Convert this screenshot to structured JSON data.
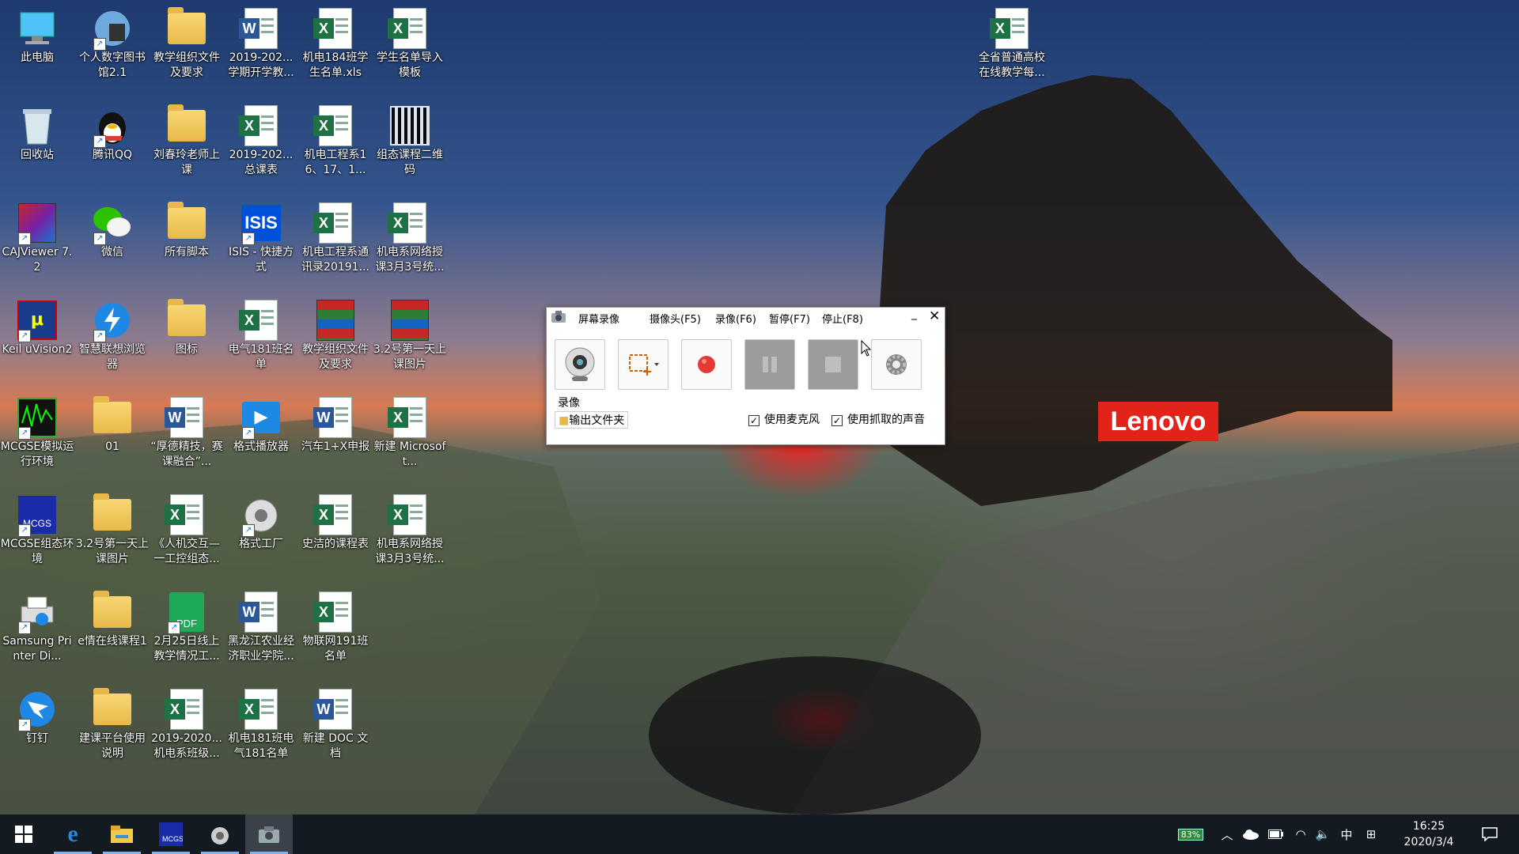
{
  "desktop": {
    "icons": [
      {
        "label": "此电脑",
        "type": "pc"
      },
      {
        "label": "个人数字图书馆2.1",
        "type": "app-globe"
      },
      {
        "label": "教学组织文件及要求",
        "type": "folder"
      },
      {
        "label": "2019-202...学期开学教...",
        "type": "word"
      },
      {
        "label": "机电184班学生名单.xls",
        "type": "excel"
      },
      {
        "label": "学生名单导入模板",
        "type": "excel"
      },
      {
        "label": "回收站",
        "type": "recycle"
      },
      {
        "label": "腾讯QQ",
        "type": "qq"
      },
      {
        "label": "刘春玲老师上课",
        "type": "folder"
      },
      {
        "label": "2019-202...总课表",
        "type": "excel"
      },
      {
        "label": "机电工程系16、17、1...",
        "type": "excel"
      },
      {
        "label": "组态课程二维码",
        "type": "qr"
      },
      {
        "label": "CAJViewer 7.2",
        "type": "caj"
      },
      {
        "label": "微信",
        "type": "wechat"
      },
      {
        "label": "所有脚本",
        "type": "folder"
      },
      {
        "label": "ISIS - 快捷方式",
        "type": "isis"
      },
      {
        "label": "机电工程系通讯录20191...",
        "type": "excel"
      },
      {
        "label": "机电系网络授课3月3号统...",
        "type": "excel"
      },
      {
        "label": "Keil uVision2",
        "type": "keil"
      },
      {
        "label": "智慧联想浏览器",
        "type": "browser"
      },
      {
        "label": "图标",
        "type": "folder"
      },
      {
        "label": "电气181班名单",
        "type": "excel"
      },
      {
        "label": "教学组织文件及要求",
        "type": "rar"
      },
      {
        "label": "3.2号第一天上课图片",
        "type": "rar"
      },
      {
        "label": "MCGSE模拟运行环境",
        "type": "mcgs"
      },
      {
        "label": "01",
        "type": "folder"
      },
      {
        "label": "“厚德精技，赛课融合”...",
        "type": "word"
      },
      {
        "label": "格式播放器",
        "type": "player"
      },
      {
        "label": "汽车1+X申报",
        "type": "word"
      },
      {
        "label": "新建 Microsoft...",
        "type": "excel"
      },
      {
        "label": "MCGSE组态环境",
        "type": "mcgs2"
      },
      {
        "label": "3.2号第一天上课图片",
        "type": "folder"
      },
      {
        "label": "《人机交互—一工控组态...",
        "type": "excel"
      },
      {
        "label": "格式工厂",
        "type": "factory"
      },
      {
        "label": "史洁的课程表",
        "type": "excel"
      },
      {
        "label": "机电系网络授课3月3号统...",
        "type": "excel"
      },
      {
        "label": "Samsung Printer Di...",
        "type": "printer"
      },
      {
        "label": "e情在线课程1",
        "type": "folder"
      },
      {
        "label": "2月25日线上教学情况工...",
        "type": "pdf"
      },
      {
        "label": "黑龙江农业经济职业学院...",
        "type": "word"
      },
      {
        "label": "物联网191班名单",
        "type": "excel"
      },
      {
        "label": "钉钉",
        "type": "dingtalk"
      },
      {
        "label": "建课平台使用说明",
        "type": "folder"
      },
      {
        "label": "2019-2020...机电系班级...",
        "type": "excel"
      },
      {
        "label": "机电181班电气181名单",
        "type": "excel"
      },
      {
        "label": "新建 DOC 文档",
        "type": "word"
      },
      {
        "label": "全省普通高校在线教学每...",
        "type": "excel"
      }
    ],
    "brand": "Lenovo"
  },
  "recorder": {
    "title": "屏幕录像",
    "menu": [
      "摄像头(F5)",
      "录像(F6)",
      "暂停(F7)",
      "停止(F8)"
    ],
    "section_label": "录像",
    "output_folder": "输出文件夹",
    "mic_label": "使用麦克风",
    "mic_checked": true,
    "capture_label": "使用抓取的声音",
    "capture_checked": true
  },
  "taskbar": {
    "battery": "83%",
    "ime": "中",
    "time": "16:25",
    "date": "2020/3/4"
  },
  "colors": {
    "taskbar": "#141a22",
    "excel": "#1e7145",
    "word": "#2b5797",
    "record": "#e53935",
    "lenovo": "#e2231a"
  }
}
